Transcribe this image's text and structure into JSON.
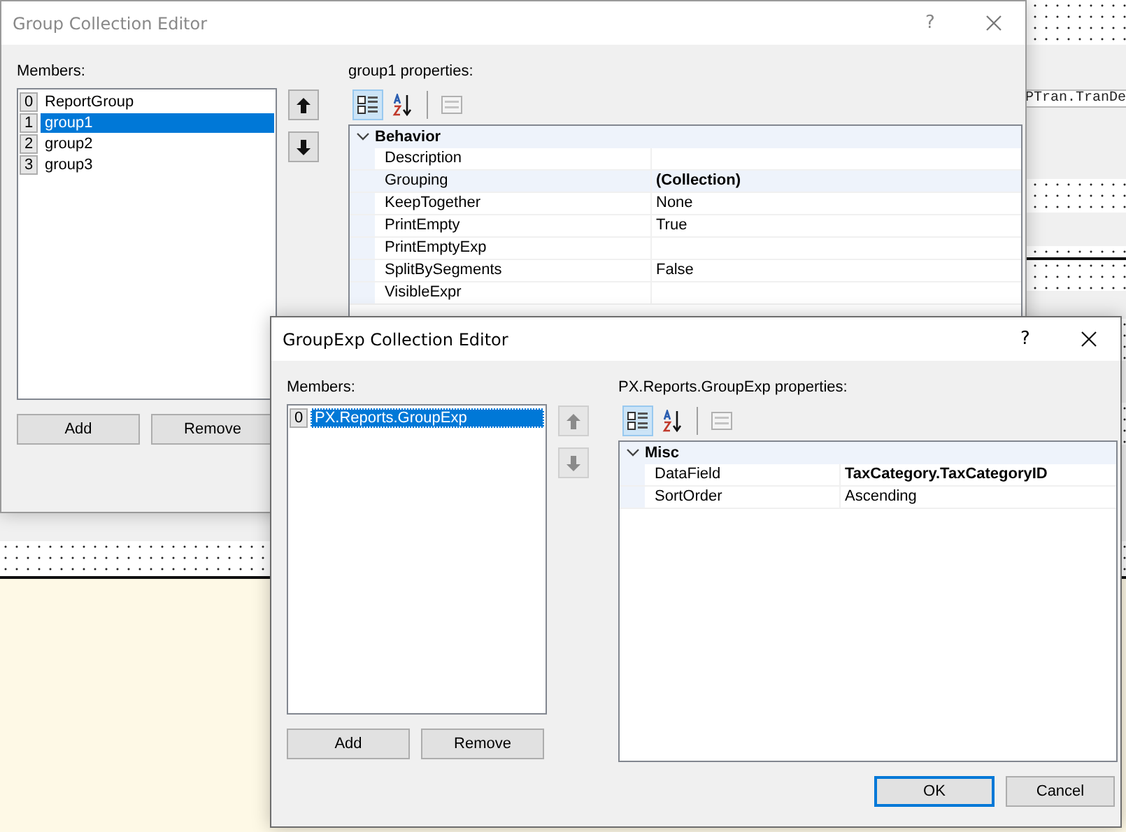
{
  "background": {
    "field_text": "PTran.TranDe"
  },
  "windows": [
    {
      "title": "Group Collection Editor",
      "active": false,
      "help_label": "?",
      "members_label": "Members:",
      "members": [
        {
          "index": "0",
          "name": "ReportGroup",
          "selected": false
        },
        {
          "index": "1",
          "name": "group1",
          "selected": true
        },
        {
          "index": "2",
          "name": "group2",
          "selected": false
        },
        {
          "index": "3",
          "name": "group3",
          "selected": false
        }
      ],
      "move_buttons_disabled": false,
      "properties_label": "group1 properties:",
      "view_buttons": [
        {
          "kind": "categorized",
          "selected": true
        },
        {
          "kind": "alphabetical",
          "selected": false
        }
      ],
      "categories": [
        {
          "name": "Behavior",
          "expanded": true,
          "rows": [
            {
              "name": "Description",
              "selected": false
            },
            {
              "name": "Grouping",
              "value": "(Collection)",
              "selected": true,
              "modified": true
            },
            {
              "name": "KeepTogether",
              "value": "None",
              "selected": false,
              "modified": false
            },
            {
              "name": "PrintEmpty",
              "value": "True",
              "selected": false,
              "modified": false
            },
            {
              "name": "PrintEmptyExp",
              "selected": false
            },
            {
              "name": "SplitBySegments",
              "value": "False",
              "selected": false,
              "modified": false
            },
            {
              "name": "VisibleExpr",
              "selected": false
            }
          ]
        }
      ],
      "list_buttons": [
        "Add",
        "Remove"
      ]
    },
    {
      "title": "GroupExp Collection Editor",
      "active": true,
      "help_label": "?",
      "members_label": "Members:",
      "members": [
        {
          "index": "0",
          "name": "PX.Reports.GroupExp",
          "selected": true
        }
      ],
      "move_buttons_disabled": true,
      "properties_label": "PX.Reports.GroupExp properties:",
      "view_buttons": [
        {
          "kind": "categorized",
          "selected": true
        },
        {
          "kind": "alphabetical",
          "selected": false
        }
      ],
      "categories": [
        {
          "name": "Misc",
          "expanded": true,
          "rows": [
            {
              "name": "DataField",
              "value": "TaxCategory.TaxCategoryID",
              "selected": false,
              "modified": true
            },
            {
              "name": "SortOrder",
              "value": "Ascending",
              "selected": false,
              "modified": false
            }
          ]
        }
      ],
      "list_buttons": [
        "Add",
        "Remove"
      ],
      "dialog_buttons": [
        {
          "label": "OK",
          "default": true
        },
        {
          "label": "Cancel",
          "default": false
        }
      ]
    }
  ]
}
